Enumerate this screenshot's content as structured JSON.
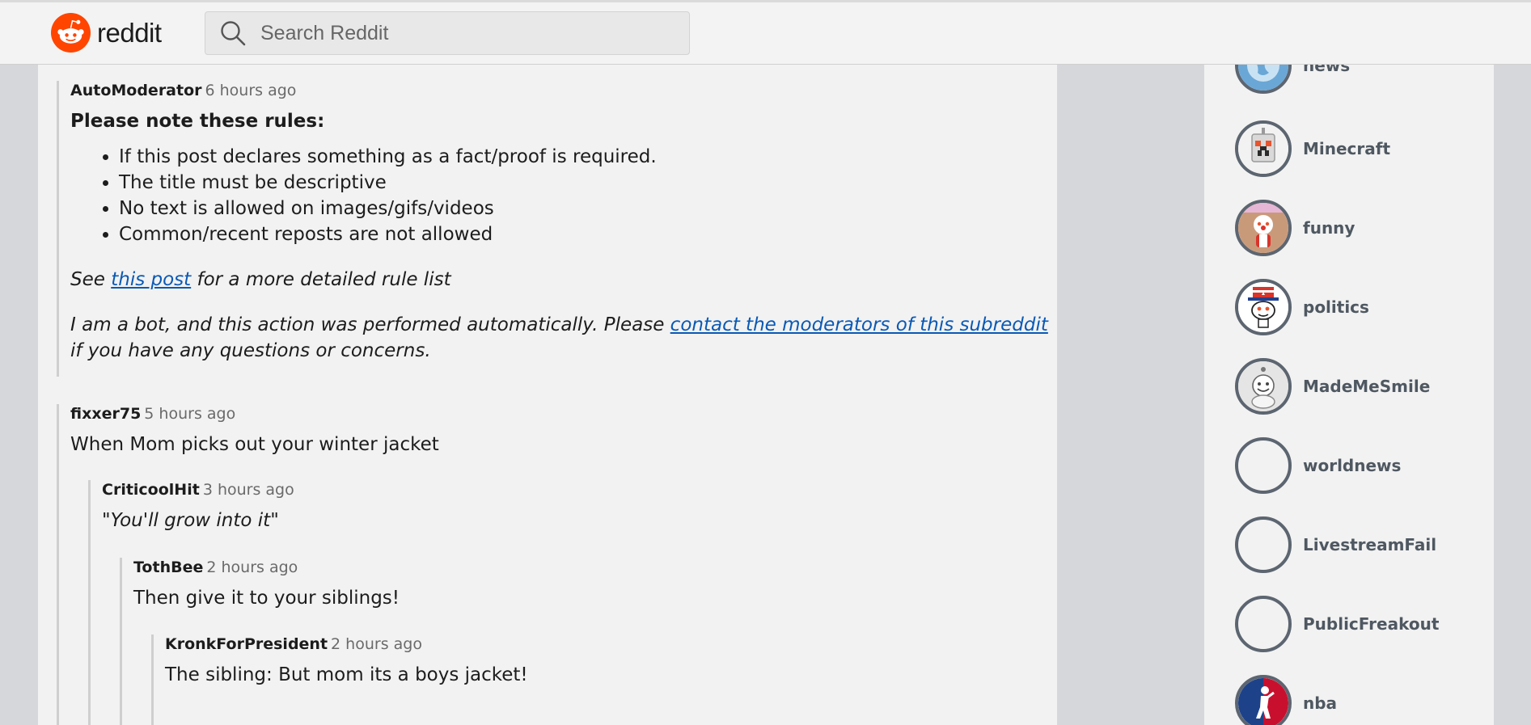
{
  "header": {
    "logo_text": "reddit",
    "search_placeholder": "Search Reddit"
  },
  "comments": [
    {
      "author": "AutoModerator",
      "time": "6 hours ago",
      "rules_title": "Please note these rules:",
      "rules": [
        "If this post declares something as a fact/proof is required.",
        "The title must be descriptive",
        "No text is allowed on images/gifs/videos",
        "Common/recent reposts are not allowed"
      ],
      "see_prefix": "See ",
      "see_link": "this post",
      "see_suffix": " for a more detailed rule list",
      "bot_prefix": "I am a bot, and this action was performed automatically. Please ",
      "bot_link": "contact the moderators of this subreddit",
      "bot_suffix": " if you have any questions or concerns."
    },
    {
      "author": "fixxer75",
      "time": "5 hours ago",
      "text": "When Mom picks out your winter jacket"
    },
    {
      "author": "CriticoolHit",
      "time": "3 hours ago",
      "text": "\"You'll grow into it\""
    },
    {
      "author": "TothBee",
      "time": "2 hours ago",
      "text": "Then give it to your siblings!"
    },
    {
      "author": "KronkForPresident",
      "time": "2 hours ago",
      "text": "The sibling: But mom its a boys jacket!"
    }
  ],
  "sidebar": {
    "subreddits": [
      {
        "name": "news",
        "icon": "globe-icon"
      },
      {
        "name": "Minecraft",
        "icon": "creeper-robot-icon"
      },
      {
        "name": "funny",
        "icon": "funny-snoo-icon"
      },
      {
        "name": "politics",
        "icon": "uncle-sam-snoo-icon"
      },
      {
        "name": "MadeMeSmile",
        "icon": "smiling-snoo-icon"
      },
      {
        "name": "worldnews",
        "icon": "empty-avatar"
      },
      {
        "name": "LivestreamFail",
        "icon": "empty-avatar"
      },
      {
        "name": "PublicFreakout",
        "icon": "empty-avatar"
      },
      {
        "name": "nba",
        "icon": "nba-logo-icon"
      }
    ]
  },
  "colors": {
    "brand_orange": "#ff4500",
    "link_blue": "#0a59b5",
    "sidebar_text": "#4f5861"
  }
}
